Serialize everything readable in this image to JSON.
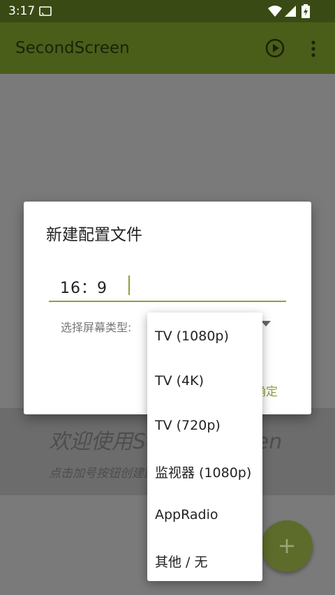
{
  "status_bar": {
    "time": "3:17",
    "icons": [
      "cast-icon",
      "wifi-icon",
      "signal-icon",
      "battery-icon"
    ]
  },
  "app_bar": {
    "title": "SecondScreen",
    "actions": [
      "play-icon",
      "more-icon"
    ],
    "color": "#4a5e1a"
  },
  "background": {
    "welcome_title": "欢迎使用SecondScreen",
    "welcome_subtitle": "点击加号按钮创建配置文件"
  },
  "dialog": {
    "title": "新建配置文件",
    "name_value": "16：9",
    "screen_type_label": "选择屏幕类型:",
    "ok_label": "确定",
    "accent_color": "#8aa23a"
  },
  "dropdown": {
    "options": [
      {
        "label": "TV (1080p)"
      },
      {
        "label": "TV (4K)"
      },
      {
        "label": "TV (720p)"
      },
      {
        "label": "监视器 (1080p)"
      },
      {
        "label": "AppRadio"
      },
      {
        "label": "其他 / 无"
      }
    ]
  },
  "fab": {
    "label": "+"
  }
}
